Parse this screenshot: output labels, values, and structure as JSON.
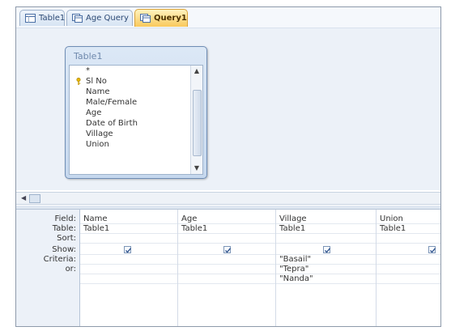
{
  "tabs": [
    {
      "label": "Table1"
    },
    {
      "label": "Age Query"
    },
    {
      "label": "Query1",
      "active": true
    }
  ],
  "table_box": {
    "title": "Table1",
    "fields": [
      "*",
      "Sl No",
      "Name",
      "Male/Female",
      "Age",
      "Date of Birth",
      "Village",
      "Union"
    ],
    "primary_key_field": "Sl No"
  },
  "grid": {
    "row_labels": {
      "field": "Field:",
      "table": "Table:",
      "sort": "Sort:",
      "show": "Show:",
      "criteria": "Criteria:",
      "or": "or:"
    },
    "columns": [
      {
        "field": "Name",
        "table": "Table1",
        "sort": "",
        "show": true,
        "criteria": "",
        "or": [
          "",
          ""
        ]
      },
      {
        "field": "Age",
        "table": "Table1",
        "sort": "",
        "show": true,
        "criteria": "",
        "or": [
          "",
          ""
        ]
      },
      {
        "field": "Village",
        "table": "Table1",
        "sort": "",
        "show": true,
        "criteria": "\"Basail\"",
        "or": [
          "\"Tepra\"",
          "\"Nanda\""
        ]
      },
      {
        "field": "Union",
        "table": "Table1",
        "sort": "",
        "show": true,
        "criteria": "",
        "or": [
          "",
          ""
        ]
      }
    ]
  },
  "colors": {
    "active_tab": "#f9c95c",
    "design_bg": "#ecf1f8",
    "checkbox_mark": "#2a4f8a"
  }
}
